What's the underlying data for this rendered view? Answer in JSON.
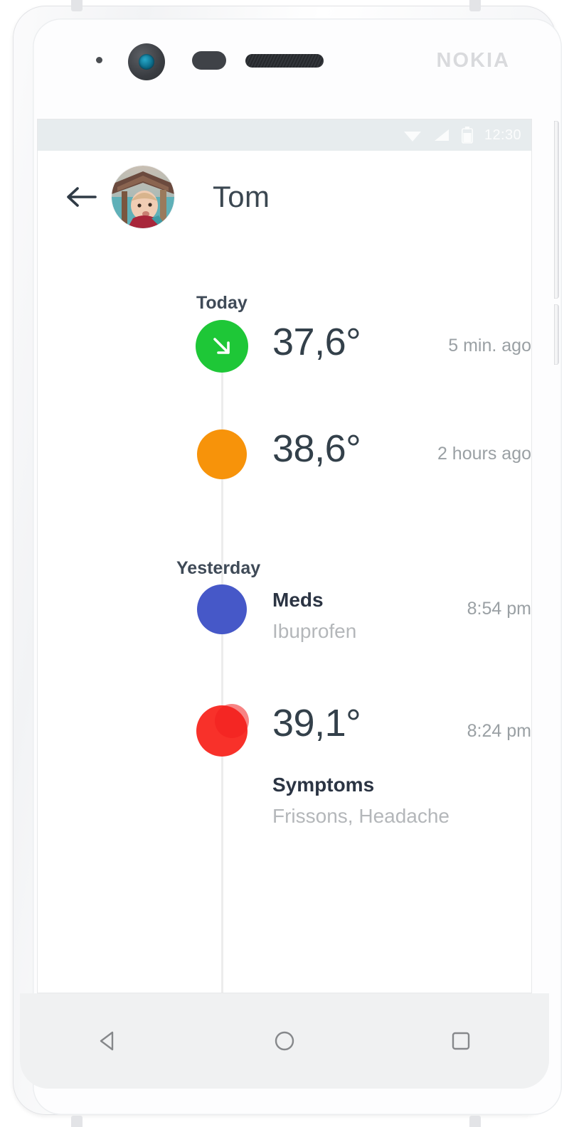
{
  "device": {
    "brand_logo": "NOKIA",
    "icons": {
      "front_camera": "front-camera-icon",
      "proximity_sensor": "proximity-sensor-icon",
      "earpiece": "earpiece-speaker-icon",
      "led": "notification-led-icon"
    }
  },
  "status_bar": {
    "wifi": "wifi-icon",
    "signal": "cellular-signal-icon",
    "battery": "battery-icon",
    "clock": "12:30"
  },
  "app_bar": {
    "back": "back-arrow-icon",
    "avatar": "user-avatar",
    "title": "Tom"
  },
  "timeline": {
    "sections": [
      {
        "heading": "Today",
        "entries": [
          {
            "time": "5 min. ago",
            "dot_color": "#1ec737",
            "dot_icon": "arrow-down-right-icon",
            "type": "temperature",
            "value": "37,6°"
          },
          {
            "time": "2 hours ago",
            "dot_color": "#f7930a",
            "dot_icon": "",
            "type": "temperature",
            "value": "38,6°"
          }
        ]
      },
      {
        "heading": "Yesterday",
        "entries": [
          {
            "time": "8:54 pm",
            "dot_color": "#4658c8",
            "dot_icon": "",
            "type": "event",
            "title": "Meds",
            "subtitle": "Ibuprofen"
          },
          {
            "time": "8:24 pm",
            "dot_color": "#f8312a",
            "dot_icon": "",
            "type": "temperature",
            "value": "39,1°",
            "title": "Symptoms",
            "subtitle": "Frissons,  Headache"
          }
        ]
      }
    ]
  },
  "nav_bar": {
    "back": "android-back-icon",
    "home": "android-home-icon",
    "recents": "android-recents-icon"
  },
  "colors": {
    "green": "#1ec737",
    "orange": "#f7930a",
    "blue": "#4658c8",
    "red": "#f8312a",
    "text_dark": "#33404a",
    "text_muted": "#9aa0a4",
    "status_bar_bg": "#e7ecee"
  }
}
